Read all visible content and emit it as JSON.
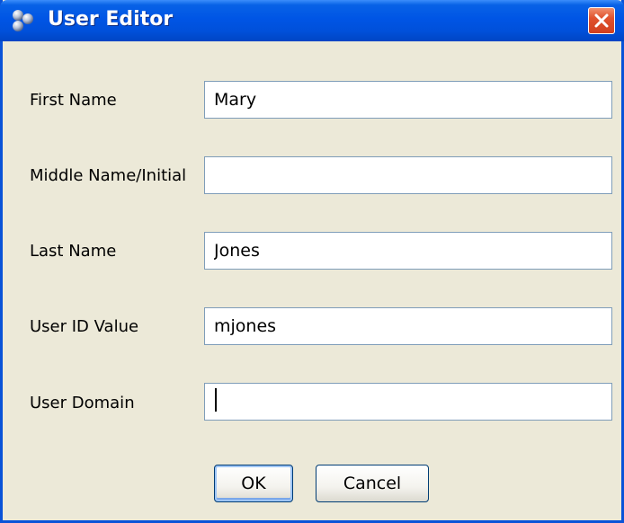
{
  "window": {
    "title": "User Editor",
    "icon": "users-group-icon",
    "close_icon": "close-icon"
  },
  "form": {
    "fields": [
      {
        "label": "First Name",
        "value": "Mary"
      },
      {
        "label": "Middle Name/Initial",
        "value": ""
      },
      {
        "label": "Last Name",
        "value": "Jones"
      },
      {
        "label": "User ID Value",
        "value": "mjones"
      },
      {
        "label": "User Domain",
        "value": ""
      }
    ]
  },
  "buttons": {
    "ok_label": "OK",
    "cancel_label": "Cancel"
  },
  "colors": {
    "titlebar": "#0055e5",
    "window_bg": "#ece9d8",
    "close_button": "#e0522e",
    "field_border": "#7f9db9"
  }
}
